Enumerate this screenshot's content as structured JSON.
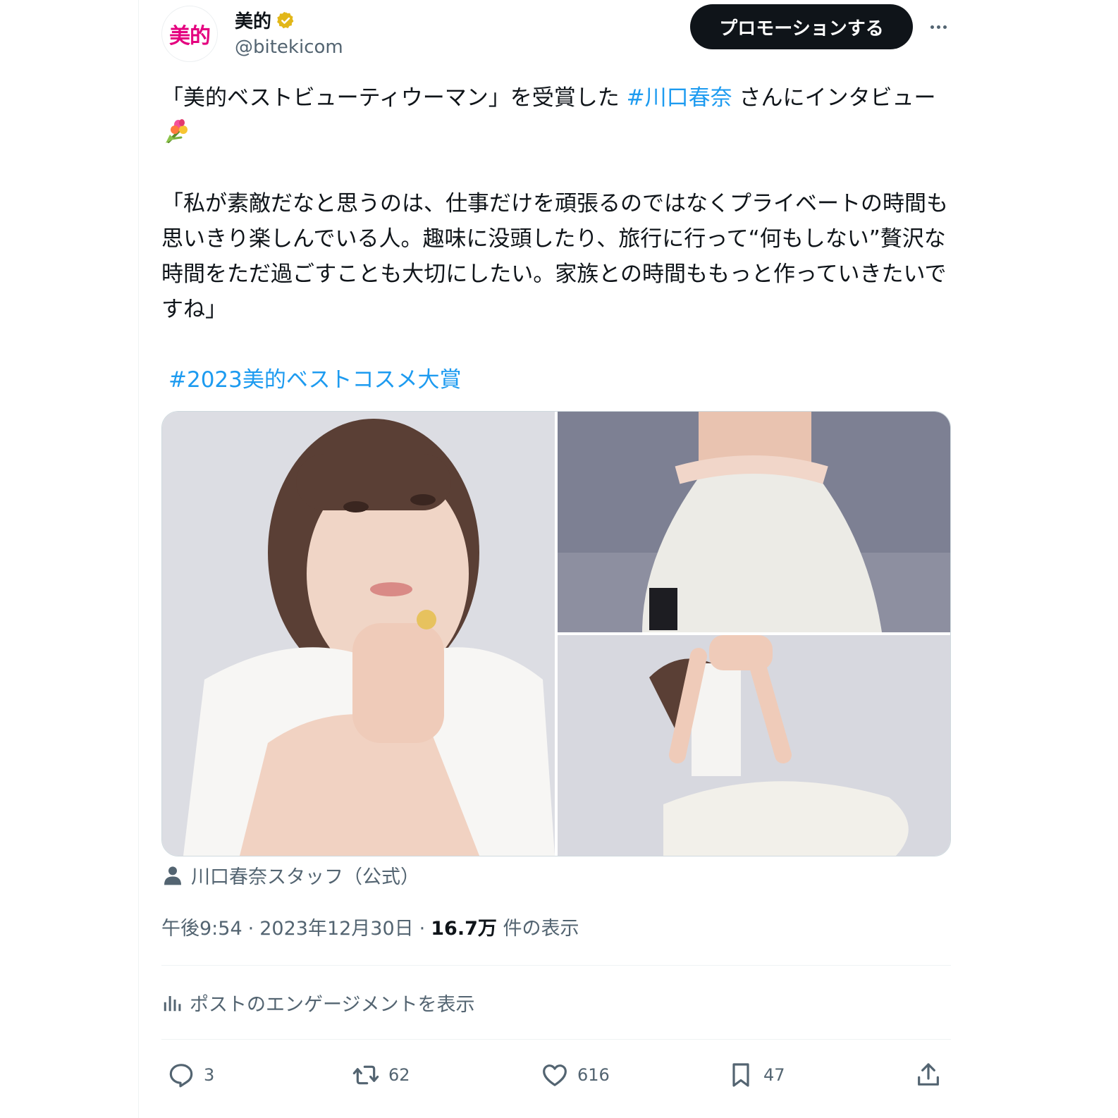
{
  "author": {
    "avatar_text": "美的",
    "name": "美的",
    "handle": "@bitekicom"
  },
  "header": {
    "promote_label": "プロモーションする"
  },
  "post": {
    "line1_a": "「美的ベストビューティウーマン」を受賞した ",
    "hashtag1": "#川口春奈",
    "line1_b": " さんにインタビュー",
    "quote": "「私が素敵だなと思うのは、仕事だけを頑張るのではなくプライベートの時間も思いきり楽しんでいる人。趣味に没頭したり、旅行に行って“何もしない”贅沢な時間をただ過ごすことも大切にしたい。家族との時間ももっと作っていきたいですね」",
    "hashtag2": "#2023美的ベストコスメ大賞",
    "emoji": "bouquet-emoji"
  },
  "media": {
    "credit": "川口春奈スタッフ（公式）"
  },
  "meta": {
    "time": "午後9:54",
    "sep": "·",
    "date": "2023年12月30日",
    "views_count": "16.7万",
    "views_label": "件の表示"
  },
  "engagement_link": "ポストのエンゲージメントを表示",
  "actions": {
    "replies": "3",
    "reposts": "62",
    "likes": "616",
    "bookmarks": "47"
  },
  "icons": [
    "verified-badge-icon",
    "more-icon",
    "person-icon",
    "analytics-icon",
    "reply-icon",
    "repost-icon",
    "like-icon",
    "bookmark-icon",
    "share-icon"
  ],
  "colors": {
    "accent": "#1d9bf0",
    "brand": "#e4007f",
    "text": "#0f1419",
    "muted": "#536471",
    "badge": "#e2b719"
  }
}
